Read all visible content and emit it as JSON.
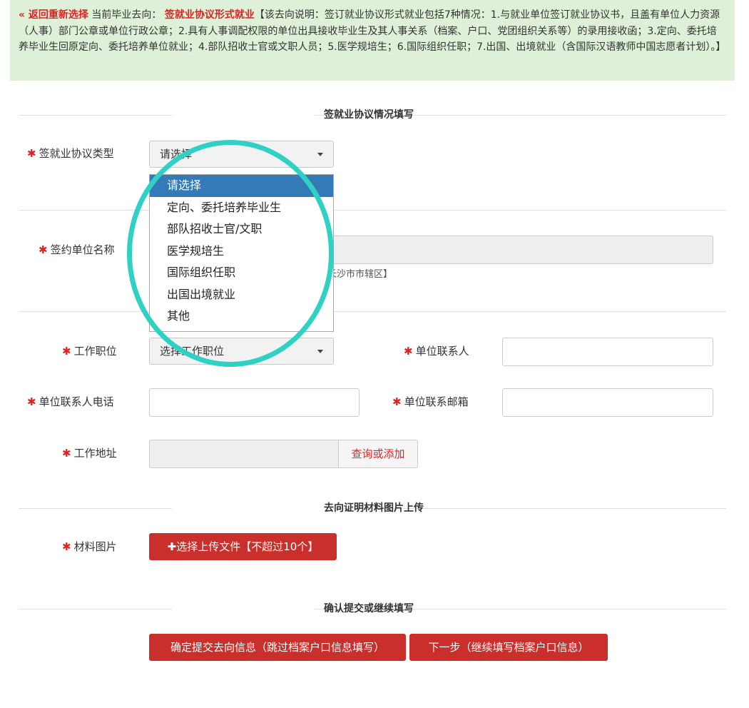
{
  "notice": {
    "back_label": "« 返回重新选择",
    "current_prefix": " 当前毕业去向：",
    "current_destination": "签就业协议形式就业",
    "description": "【该去向说明：签订就业协议形式就业包括7种情况：1.与就业单位签订就业协议书，且盖有单位人力资源（人事）部门公章或单位行政公章；2.具有人事调配权限的单位出具接收毕业生及其人事关系（档案、户口、党团组织关系等）的录用接收函；3.定向、委托培养毕业生回原定向、委托培养单位就业；4.部队招收士官或文职人员；5.医学规培生；6.国际组织任职；7.出国、出境就业（含国际汉语教师中国志愿者计划）。】"
  },
  "sections": {
    "agreement": "签就业协议情况填写",
    "upload": "去向证明材料图片上传",
    "confirm": "确认提交或继续填写"
  },
  "form": {
    "required_mark": "✱",
    "agreement_type_label": "签就业协议类型",
    "agreement_type_value": "请选择",
    "agreement_type_options": [
      "请选择",
      "定向、委托培养毕业生",
      "部队招收士官/文职",
      "医学规培生",
      "国际组织任职",
      "出国出境就业",
      "其他"
    ],
    "unit_name_label": "签约单位名称",
    "unit_name_hint": "长沙市市辖区】",
    "position_label": "工作职位",
    "position_value": "选择工作职位",
    "contact_label": "单位联系人",
    "contact_phone_label": "单位联系人电话",
    "contact_email_label": "单位联系邮箱",
    "address_label": "工作地址",
    "address_button": "查询或添加",
    "material_label": "材料图片",
    "upload_button": "✚选择上传文件【不超过10个】"
  },
  "actions": {
    "submit": "确定提交去向信息（跳过档案户口信息填写）",
    "next": "下一步（继续填写档案户口信息）"
  },
  "colors": {
    "required": "#e02222",
    "button": "#c9302c",
    "notice_bg": "#dff0d8",
    "highlight_circle": "#2ed1c4",
    "selected_option": "#337ab7"
  }
}
